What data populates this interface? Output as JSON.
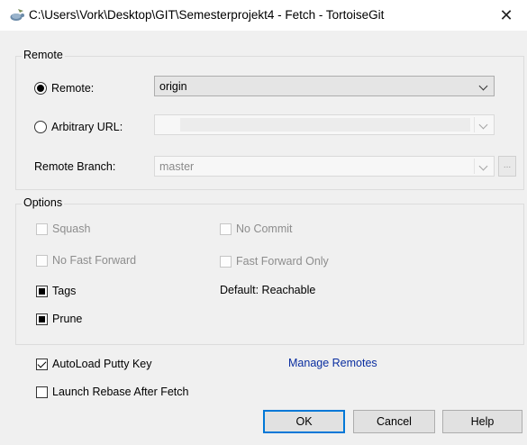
{
  "window": {
    "title": "C:\\Users\\Vork\\Desktop\\GIT\\Semesterprojekt4 - Fetch - TortoiseGit",
    "close_glyph": "✕",
    "icon": "tortoisegit-icon"
  },
  "remote_group": {
    "label": "Remote",
    "remote_radio_label": "Remote:",
    "remote_value": "origin",
    "arbitrary_radio_label": "Arbitrary URL:",
    "arbitrary_value": "",
    "branch_label": "Remote Branch:",
    "branch_value": "master",
    "browse_label": "..."
  },
  "options_group": {
    "label": "Options",
    "squash": "Squash",
    "no_commit": "No Commit",
    "no_fast_forward": "No Fast Forward",
    "fast_forward_only": "Fast Forward Only",
    "tags": "Tags",
    "tags_default": "Default: Reachable",
    "prune": "Prune"
  },
  "bottom": {
    "autoload_putty": "AutoLoad Putty Key",
    "launch_rebase": "Launch Rebase After Fetch",
    "manage_remotes": "Manage Remotes"
  },
  "buttons": {
    "ok": "OK",
    "cancel": "Cancel",
    "help": "Help"
  },
  "colors": {
    "accent": "#0078d7",
    "link": "#0a2ea0"
  }
}
